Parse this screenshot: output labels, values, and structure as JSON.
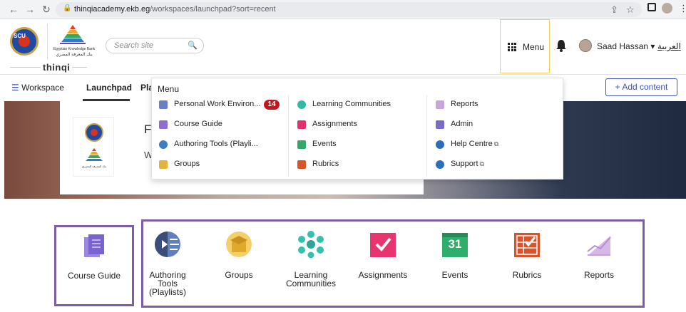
{
  "browser": {
    "url_host": "thinqiacademy.ekb.eg",
    "url_path": "/workspaces/launchpad?sort=recent"
  },
  "header": {
    "logo_scu": "SCU",
    "ekb_en": "Egyptian Knowledge Bank",
    "ekb_ar": "بنك المعرفة المصري",
    "brand": "thinqi",
    "search_placeholder": "Search site",
    "menu_label": "Menu",
    "user_name": "Saad Hassan",
    "arabic_link": "العربية"
  },
  "subnav": {
    "workspace": "Workspace",
    "launchpad": "Launchpad",
    "partial": "Pla",
    "add_content": "Add content"
  },
  "banner": {
    "title_partial": "Fa",
    "subtitle_partial": "We"
  },
  "dropdown": {
    "title": "Menu",
    "col1": [
      {
        "label": "Personal Work Environ...",
        "badge": "14",
        "color": "#6b7fc9"
      },
      {
        "label": "Course Guide",
        "color": "#8a6fd1"
      },
      {
        "label": "Authoring Tools (Playli...",
        "color": "#3d7dc4"
      },
      {
        "label": "Groups",
        "color": "#e2b23c"
      }
    ],
    "col2": [
      {
        "label": "Learning Communities",
        "color": "#35b7a6"
      },
      {
        "label": "Assignments",
        "color": "#e0336e"
      },
      {
        "label": "Events",
        "color": "#32a86a"
      },
      {
        "label": "Rubrics",
        "color": "#d8542a"
      }
    ],
    "col3": [
      {
        "label": "Reports",
        "color": "#c8a6dd"
      },
      {
        "label": "Admin",
        "color": "#7a6cc9"
      },
      {
        "label": "Help Centre",
        "color": "#2a6ebc",
        "ext": "⧉"
      },
      {
        "label": "Support",
        "color": "#2a6ebc",
        "ext": "⧉"
      }
    ]
  },
  "tiles": {
    "course_guide": "Course Guide",
    "authoring_1": "Authoring",
    "authoring_2": "Tools",
    "authoring_3": "(Playlists)",
    "groups": "Groups",
    "learning_1": "Learning",
    "learning_2": "Communities",
    "assignments": "Assignments",
    "events": "Events",
    "events_num": "31",
    "rubrics": "Rubrics",
    "reports": "Reports"
  },
  "colors": {
    "accent": "#3f51b5",
    "highlight_frame": "#7b5ea7",
    "menu_focus": "#f2d45c",
    "badge": "#c4161c"
  }
}
